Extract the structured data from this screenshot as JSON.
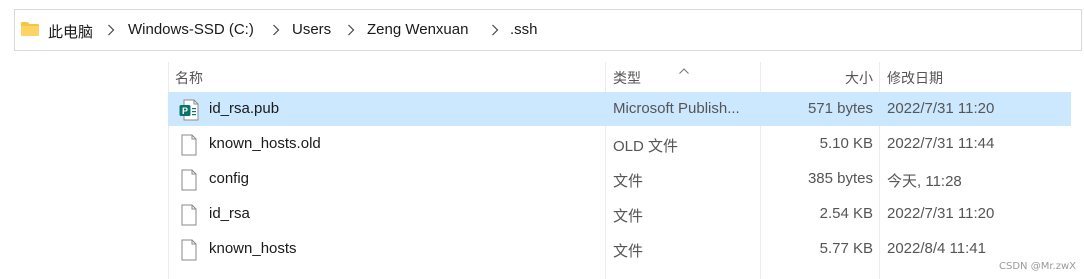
{
  "breadcrumb": {
    "items": [
      "此电脑",
      "Windows-SSD (C:)",
      "Users",
      "Zeng Wenxuan",
      ".ssh"
    ]
  },
  "columns": {
    "name": "名称",
    "type": "类型",
    "size": "大小",
    "date": "修改日期"
  },
  "files": [
    {
      "name": "id_rsa.pub",
      "type": "Microsoft Publish...",
      "size": "571 bytes",
      "date": "2022/7/31 11:20",
      "icon": "publisher-file-icon",
      "selected": true
    },
    {
      "name": "known_hosts.old",
      "type": "OLD 文件",
      "size": "5.10 KB",
      "date": "2022/7/31 11:44",
      "icon": "generic-file-icon",
      "selected": false
    },
    {
      "name": "config",
      "type": "文件",
      "size": "385 bytes",
      "date": "今天, 11:28",
      "icon": "generic-file-icon",
      "selected": false
    },
    {
      "name": "id_rsa",
      "type": "文件",
      "size": "2.54 KB",
      "date": "2022/7/31 11:20",
      "icon": "generic-file-icon",
      "selected": false
    },
    {
      "name": "known_hosts",
      "type": "文件",
      "size": "5.77 KB",
      "date": "2022/8/4 11:41",
      "icon": "generic-file-icon",
      "selected": false
    }
  ],
  "watermark": "CSDN @Mr.zwX",
  "colors": {
    "selection": "#cce8ff",
    "folder": "#f8c443",
    "publisher": "#077568"
  }
}
